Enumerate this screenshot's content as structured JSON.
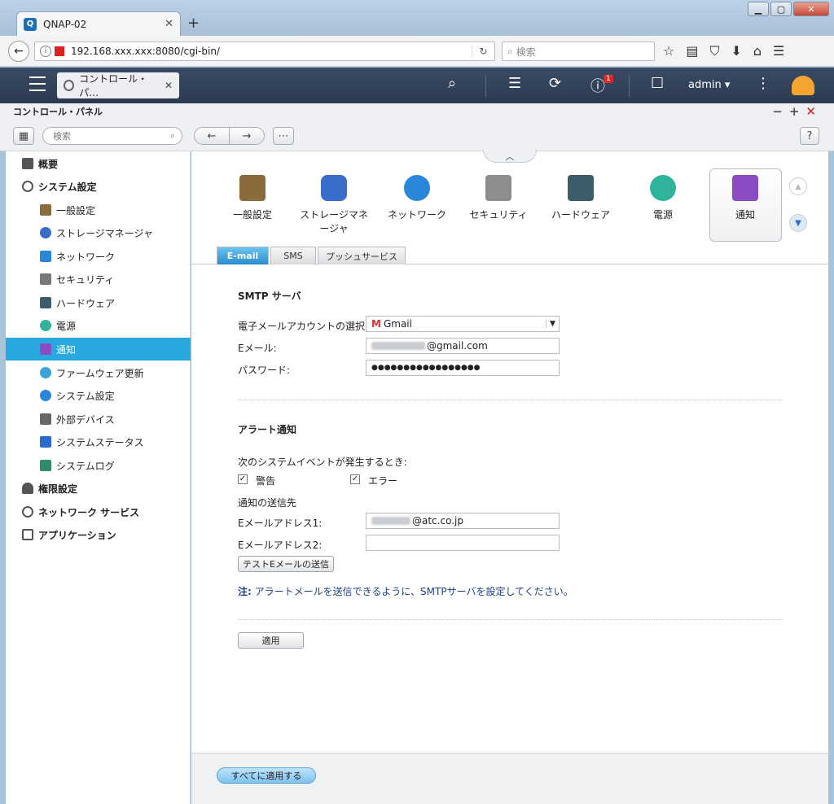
{
  "browser": {
    "tab_title": "QNAP-02",
    "url": "192.168.xxx.xxx:8080/cgi-bin/",
    "search_placeholder": "検索"
  },
  "qnap": {
    "app_tab": "コントロール・パ…",
    "notification_count": "1",
    "user": "admin ▾"
  },
  "panel": {
    "title": "コントロール・パネル",
    "search_placeholder": "検索",
    "help": "?"
  },
  "sidebar": {
    "overview": "概要",
    "system_settings": "システム設定",
    "items": [
      {
        "label": "一般設定",
        "color": "#8a6b3c"
      },
      {
        "label": "ストレージマネージャ",
        "color": "#3a6cc9"
      },
      {
        "label": "ネットワーク",
        "color": "#2a86d8"
      },
      {
        "label": "セキュリティ",
        "color": "#777777"
      },
      {
        "label": "ハードウェア",
        "color": "#3c5c6a"
      },
      {
        "label": "電源",
        "color": "#2fb39a"
      },
      {
        "label": "通知",
        "color": "#8a4cc0"
      },
      {
        "label": "ファームウェア更新",
        "color": "#3aa4d8"
      },
      {
        "label": "システム設定",
        "color": "#2a86d8"
      },
      {
        "label": "外部デバイス",
        "color": "#666666"
      },
      {
        "label": "システムステータス",
        "color": "#2a6cc9"
      },
      {
        "label": "システムログ",
        "color": "#2f8c6a"
      }
    ],
    "permissions": "権限設定",
    "network_services": "ネットワーク サービス",
    "applications": "アプリケーション"
  },
  "categories": [
    {
      "label": "一般設定",
      "color": "#8a6b3c"
    },
    {
      "label": "ストレージマネージャ",
      "color": "#3a6cc9"
    },
    {
      "label": "ネットワーク",
      "color": "#2a86d8"
    },
    {
      "label": "セキュリティ",
      "color": "#8d8d8d"
    },
    {
      "label": "ハードウェア",
      "color": "#3c5c6a"
    },
    {
      "label": "電源",
      "color": "#2fb39a"
    },
    {
      "label": "通知",
      "color": "#8a4cc0"
    }
  ],
  "tabs": [
    "E-mail",
    "SMS",
    "プッシュサービス"
  ],
  "smtp": {
    "heading": "SMTP サーバ",
    "account_label": "電子メールアカウントの選択:",
    "account_value": "Gmail",
    "email_label": "Eメール:",
    "email_value": "@gmail.com",
    "password_label": "パスワード:",
    "password_value": "●●●●●●●●●●●●●●●●●"
  },
  "alert": {
    "heading": "アラート通知",
    "event_label": "次のシステムイベントが発生するとき:",
    "warning": "警告",
    "error": "エラー",
    "dest_label": "通知の送信先",
    "addr1_label": "Eメールアドレス1:",
    "addr1_value": "@atc.co.jp",
    "addr2_label": "Eメールアドレス2:",
    "addr2_value": "",
    "test_button": "テストEメールの送信",
    "note_prefix": "注:",
    "note": " アラートメールを送信できるように、SMTPサーバを設定してください。"
  },
  "actions": {
    "apply": "適用",
    "apply_all": "すべてに適用する"
  }
}
